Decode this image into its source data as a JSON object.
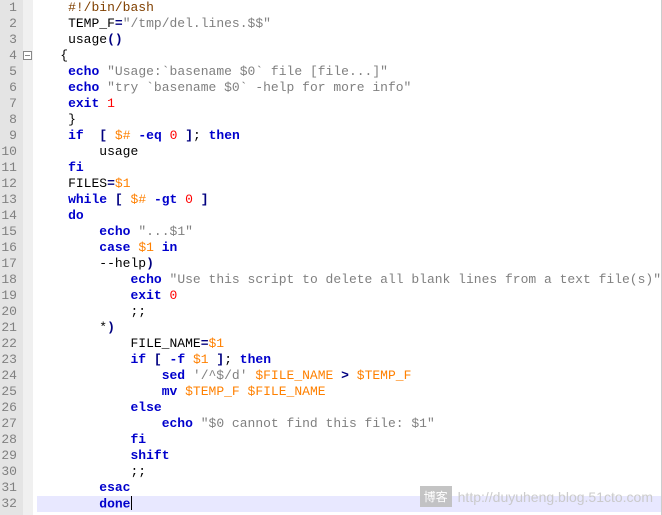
{
  "lines": [
    {
      "n": 1,
      "tokens": [
        [
          "    ",
          "nm"
        ],
        [
          "#!/bin/bash",
          "pp"
        ]
      ]
    },
    {
      "n": 2,
      "tokens": [
        [
          "    ",
          "nm"
        ],
        [
          "TEMP_F",
          "nm"
        ],
        [
          "=",
          "op"
        ],
        [
          "\"/tmp/del.lines.$$\"",
          "str"
        ]
      ]
    },
    {
      "n": 3,
      "tokens": [
        [
          "    ",
          "nm"
        ],
        [
          "usage",
          "nm"
        ],
        [
          "()",
          "op"
        ]
      ]
    },
    {
      "n": 4,
      "fold": true,
      "tokens": [
        [
          "   {",
          "nm"
        ]
      ]
    },
    {
      "n": 5,
      "tokens": [
        [
          "    ",
          "nm"
        ],
        [
          "echo",
          "kw"
        ],
        [
          " ",
          "nm"
        ],
        [
          "\"Usage:`basename $0` file [file...]\"",
          "str"
        ]
      ]
    },
    {
      "n": 6,
      "tokens": [
        [
          "    ",
          "nm"
        ],
        [
          "echo",
          "kw"
        ],
        [
          " ",
          "nm"
        ],
        [
          "\"try `basename $0` -help for more info\"",
          "str"
        ]
      ]
    },
    {
      "n": 7,
      "tokens": [
        [
          "    ",
          "nm"
        ],
        [
          "exit",
          "kw"
        ],
        [
          " ",
          "nm"
        ],
        [
          "1",
          "num"
        ]
      ]
    },
    {
      "n": 8,
      "tokens": [
        [
          "    }",
          "nm"
        ]
      ]
    },
    {
      "n": 9,
      "tokens": [
        [
          "    ",
          "nm"
        ],
        [
          "if",
          "kw"
        ],
        [
          "  ",
          "nm"
        ],
        [
          "[",
          "op"
        ],
        [
          " ",
          "nm"
        ],
        [
          "$#",
          "var"
        ],
        [
          " ",
          "nm"
        ],
        [
          "-eq",
          "kw"
        ],
        [
          " ",
          "nm"
        ],
        [
          "0",
          "num"
        ],
        [
          " ",
          "nm"
        ],
        [
          "]",
          "op"
        ],
        [
          "; ",
          "nm"
        ],
        [
          "then",
          "kw"
        ]
      ]
    },
    {
      "n": 10,
      "tokens": [
        [
          "        usage",
          "nm"
        ]
      ]
    },
    {
      "n": 11,
      "tokens": [
        [
          "    ",
          "nm"
        ],
        [
          "fi",
          "kw"
        ]
      ]
    },
    {
      "n": 12,
      "tokens": [
        [
          "    ",
          "nm"
        ],
        [
          "FILES",
          "nm"
        ],
        [
          "=",
          "op"
        ],
        [
          "$1",
          "var"
        ]
      ]
    },
    {
      "n": 13,
      "tokens": [
        [
          "    ",
          "nm"
        ],
        [
          "while",
          "kw"
        ],
        [
          " ",
          "nm"
        ],
        [
          "[",
          "op"
        ],
        [
          " ",
          "nm"
        ],
        [
          "$#",
          "var"
        ],
        [
          " ",
          "nm"
        ],
        [
          "-gt",
          "kw"
        ],
        [
          " ",
          "nm"
        ],
        [
          "0",
          "num"
        ],
        [
          " ",
          "nm"
        ],
        [
          "]",
          "op"
        ]
      ]
    },
    {
      "n": 14,
      "tokens": [
        [
          "    ",
          "nm"
        ],
        [
          "do",
          "kw"
        ]
      ]
    },
    {
      "n": 15,
      "tokens": [
        [
          "        ",
          "nm"
        ],
        [
          "echo",
          "kw"
        ],
        [
          " ",
          "nm"
        ],
        [
          "\"...$1\"",
          "str"
        ]
      ]
    },
    {
      "n": 16,
      "tokens": [
        [
          "        ",
          "nm"
        ],
        [
          "case",
          "kw"
        ],
        [
          " ",
          "nm"
        ],
        [
          "$1",
          "var"
        ],
        [
          " ",
          "nm"
        ],
        [
          "in",
          "kw"
        ]
      ]
    },
    {
      "n": 17,
      "tokens": [
        [
          "        --help",
          ""
        ],
        [
          ")",
          "op"
        ]
      ]
    },
    {
      "n": 18,
      "tokens": [
        [
          "            ",
          "nm"
        ],
        [
          "echo",
          "kw"
        ],
        [
          " ",
          "nm"
        ],
        [
          "\"Use this script to delete all blank lines from a text file(s)\"",
          "str"
        ]
      ]
    },
    {
      "n": 19,
      "tokens": [
        [
          "            ",
          "nm"
        ],
        [
          "exit",
          "kw"
        ],
        [
          " ",
          "nm"
        ],
        [
          "0",
          "num"
        ]
      ]
    },
    {
      "n": 20,
      "tokens": [
        [
          "            ;;",
          "nm"
        ]
      ]
    },
    {
      "n": 21,
      "tokens": [
        [
          "        *",
          ""
        ],
        [
          ")",
          "op"
        ]
      ]
    },
    {
      "n": 22,
      "tokens": [
        [
          "            FILE_NAME",
          "nm"
        ],
        [
          "=",
          "op"
        ],
        [
          "$1",
          "var"
        ]
      ]
    },
    {
      "n": 23,
      "tokens": [
        [
          "            ",
          "nm"
        ],
        [
          "if",
          "kw"
        ],
        [
          " ",
          "nm"
        ],
        [
          "[",
          "op"
        ],
        [
          " ",
          "nm"
        ],
        [
          "-f",
          "kw"
        ],
        [
          " ",
          "nm"
        ],
        [
          "$1",
          "var"
        ],
        [
          " ",
          "nm"
        ],
        [
          "]",
          "op"
        ],
        [
          "; ",
          "nm"
        ],
        [
          "then",
          "kw"
        ]
      ]
    },
    {
      "n": 24,
      "tokens": [
        [
          "                ",
          "nm"
        ],
        [
          "sed",
          "kw"
        ],
        [
          " ",
          "nm"
        ],
        [
          "'/^$/d'",
          "str"
        ],
        [
          " ",
          "nm"
        ],
        [
          "$FILE_NAME",
          "var"
        ],
        [
          " ",
          "nm"
        ],
        [
          ">",
          "op"
        ],
        [
          " ",
          "nm"
        ],
        [
          "$TEMP_F",
          "var"
        ]
      ]
    },
    {
      "n": 25,
      "tokens": [
        [
          "                ",
          "nm"
        ],
        [
          "mv",
          "kw"
        ],
        [
          " ",
          "nm"
        ],
        [
          "$TEMP_F",
          "var"
        ],
        [
          " ",
          "nm"
        ],
        [
          "$FILE_NAME",
          "var"
        ]
      ]
    },
    {
      "n": 26,
      "tokens": [
        [
          "            ",
          "nm"
        ],
        [
          "else",
          "kw"
        ]
      ]
    },
    {
      "n": 27,
      "tokens": [
        [
          "                ",
          "nm"
        ],
        [
          "echo",
          "kw"
        ],
        [
          " ",
          "nm"
        ],
        [
          "\"$0 cannot find this file: $1\"",
          "str"
        ]
      ]
    },
    {
      "n": 28,
      "tokens": [
        [
          "            ",
          "nm"
        ],
        [
          "fi",
          "kw"
        ]
      ]
    },
    {
      "n": 29,
      "tokens": [
        [
          "            ",
          "nm"
        ],
        [
          "shift",
          "kw"
        ]
      ]
    },
    {
      "n": 30,
      "tokens": [
        [
          "            ;;",
          "nm"
        ]
      ]
    },
    {
      "n": 31,
      "tokens": [
        [
          "        ",
          "nm"
        ],
        [
          "esac",
          "kw"
        ]
      ]
    },
    {
      "n": 32,
      "hl": true,
      "tokens": [
        [
          "        ",
          "nm"
        ],
        [
          "done",
          "kw"
        ]
      ],
      "caret": true
    }
  ],
  "watermark": {
    "badge": "博客",
    "url": "http://duyuheng.blog.51cto.com"
  }
}
